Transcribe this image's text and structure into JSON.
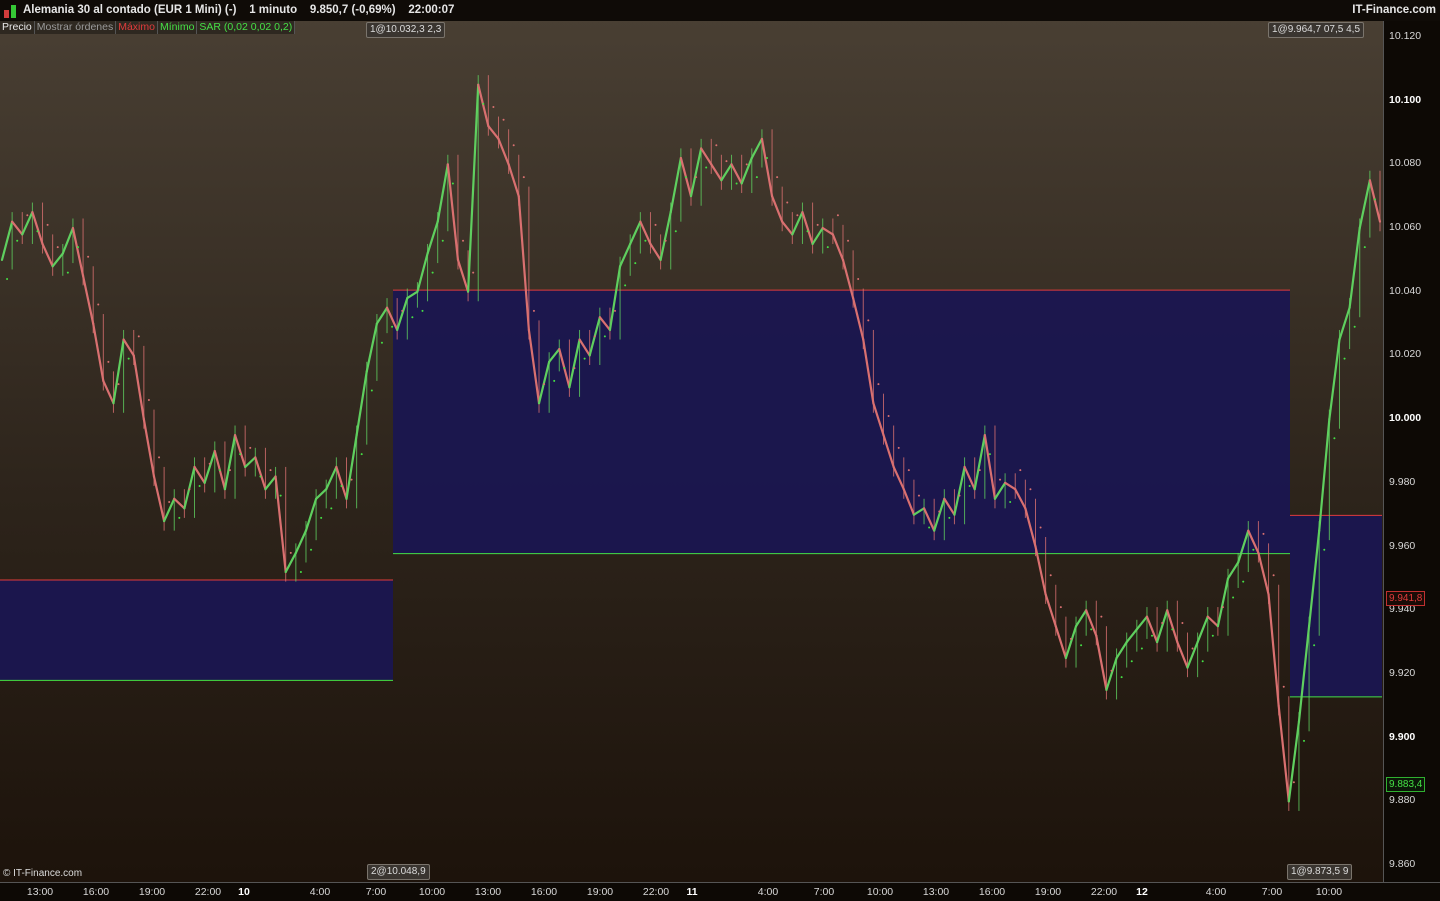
{
  "header": {
    "title": "Alemania 30 al contado (EUR 1 Mini) (-)",
    "interval": "1 minuto",
    "last_price": "9.850,7 (-0,69%)",
    "time": "22:00:07",
    "brand": "IT-Finance.com"
  },
  "legend": {
    "price": "Precio",
    "orders": "Mostrar órdenes",
    "max": "Máximo",
    "min": "Mínimo",
    "sar": "SAR (0,02 0,02 0,2)"
  },
  "colors": {
    "max": "#e03b3b",
    "min": "#45e045",
    "zone": "#1a1650",
    "up": "#5fcf5f",
    "down": "#d97070"
  },
  "order_tags": {
    "top_left": "1@10.032,3",
    "top_left_extra": "2,3",
    "top_right": "1@9.964,7",
    "top_right_b": "07,5",
    "top_right_c": "4,5",
    "bottom_left": "2@10.048,9",
    "bottom_right": "1@9.873,5",
    "bottom_right_extra": "9"
  },
  "copyright": "© IT-Finance.com",
  "price_labels": {
    "max": "9.941,8",
    "min": "9.883,4"
  },
  "chart_data": {
    "type": "line",
    "ylim": [
      9855,
      10125
    ],
    "y_ticks": [
      "10.120",
      "10.100",
      "10.080",
      "10.060",
      "10.040",
      "10.020",
      "10.000",
      "9.980",
      "9.960",
      "9.940",
      "9.920",
      "9.900",
      "9.880",
      "9.860"
    ],
    "x_ticks": [
      "13:00",
      "16:00",
      "19:00",
      "22:00",
      "10",
      "4:00",
      "7:00",
      "10:00",
      "13:00",
      "16:00",
      "19:00",
      "22:00",
      "11",
      "4:00",
      "7:00",
      "10:00",
      "13:00",
      "16:00",
      "19:00",
      "22:00",
      "12",
      "4:00",
      "7:00",
      "10:00"
    ],
    "day_ticks": [
      "10",
      "11",
      "12"
    ],
    "series": [
      {
        "name": "Precio",
        "values": [
          10050,
          10062,
          10058,
          10065,
          10055,
          10048,
          10052,
          10060,
          10045,
          10030,
          10012,
          10005,
          10025,
          10020,
          10000,
          9982,
          9968,
          9975,
          9972,
          9985,
          9980,
          9990,
          9978,
          9995,
          9985,
          9988,
          9978,
          9982,
          9952,
          9958,
          9965,
          9975,
          9978,
          9985,
          9975,
          9995,
          10015,
          10030,
          10035,
          10028,
          10038,
          10040,
          10052,
          10062,
          10080,
          10050,
          10040,
          10105,
          10092,
          10088,
          10080,
          10070,
          10028,
          10005,
          10018,
          10022,
          10010,
          10025,
          10020,
          10032,
          10028,
          10048,
          10055,
          10062,
          10055,
          10050,
          10065,
          10082,
          10070,
          10085,
          10080,
          10075,
          10080,
          10074,
          10082,
          10088,
          10070,
          10062,
          10058,
          10065,
          10055,
          10060,
          10058,
          10050,
          10038,
          10025,
          10005,
          9995,
          9985,
          9978,
          9970,
          9972,
          9965,
          9975,
          9970,
          9985,
          9978,
          9995,
          9975,
          9980,
          9978,
          9972,
          9960,
          9945,
          9935,
          9925,
          9935,
          9940,
          9932,
          9915,
          9925,
          9930,
          9934,
          9938,
          9930,
          9940,
          9930,
          9922,
          9930,
          9938,
          9935,
          9950,
          9955,
          9965,
          9958,
          9945,
          9910,
          9880,
          9905,
          9935,
          9965,
          10000,
          10025,
          10035,
          10060,
          10075,
          10062
        ]
      }
    ],
    "zones": [
      {
        "day": "9",
        "max": 9949.5,
        "min": 9918
      },
      {
        "day": "10",
        "max": 10040.5,
        "min": 9957.8
      },
      {
        "day": "12",
        "max": 9969.8,
        "min": 9912.8
      }
    ]
  }
}
